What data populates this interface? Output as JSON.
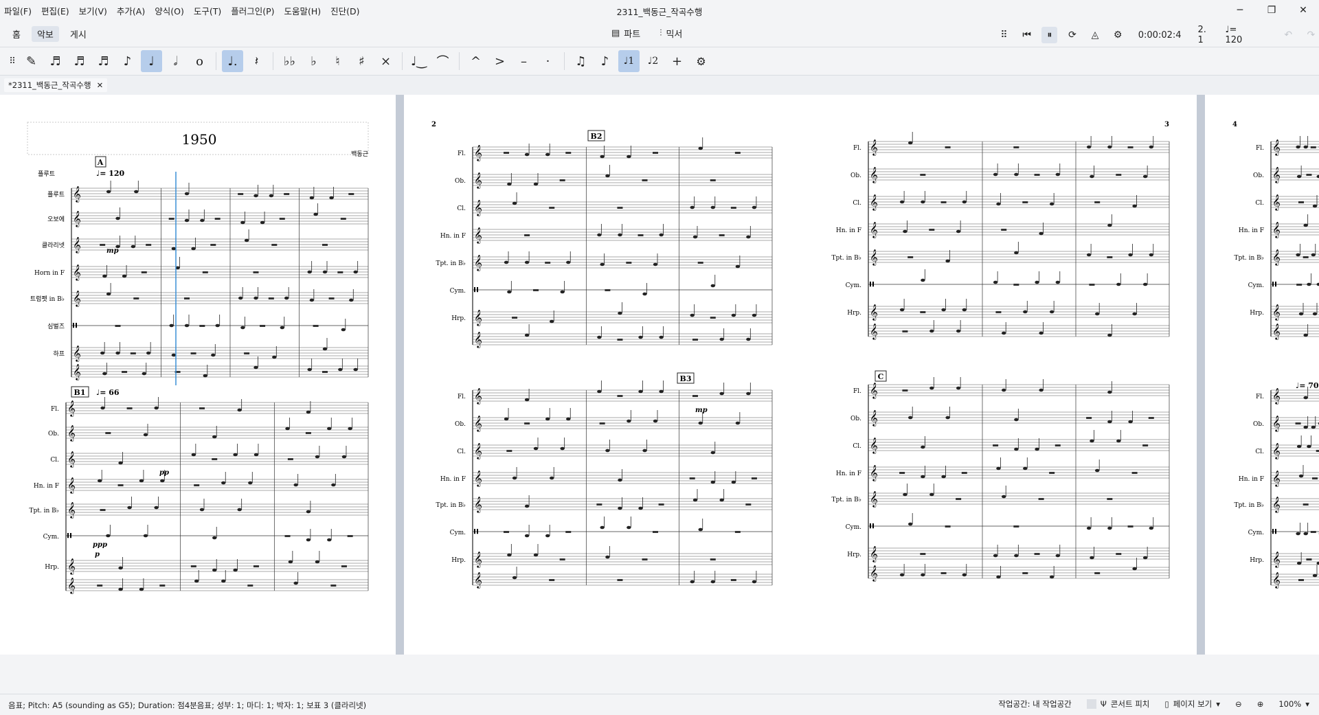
{
  "menubar": {
    "menus": [
      "파일(F)",
      "편집(E)",
      "보기(V)",
      "추가(A)",
      "양식(O)",
      "도구(T)",
      "플러그인(P)",
      "도움말(H)",
      "진단(D)"
    ],
    "window_title": "2311_백동근_작곡수행"
  },
  "nav_tabs": {
    "home": "홈",
    "score": "악보",
    "publish": "게시"
  },
  "center_tabs": {
    "parts": "파트",
    "mixer": "믹서"
  },
  "playback": {
    "time": "0:00:02:4",
    "position": "2. 1",
    "tempo": "♩= 120"
  },
  "note_input": {
    "tools": [
      "pen-icon",
      "64th-note-icon",
      "32nd-note-icon",
      "16th-note-icon",
      "eighth-note-icon",
      "quarter-note-icon",
      "half-note-icon",
      "whole-note-icon",
      "augmentation-dot-icon",
      "rest-icon",
      "double-flat-icon",
      "flat-icon",
      "natural-icon",
      "sharp-icon",
      "double-sharp-icon",
      "tie-icon",
      "slur-icon",
      "marcato-icon",
      "accent-icon",
      "tenuto-icon",
      "staccato-icon",
      "tuplet-icon",
      "flip-icon",
      "voice-1-icon",
      "voice-2-icon",
      "add-icon",
      "settings-icon"
    ]
  },
  "doc_tab": {
    "label": "*2311_백동근_작곡수행"
  },
  "score": {
    "title": "1950",
    "composer": "백동근",
    "tempo_a": "♩= 120",
    "tempo_b1": "♩= 66",
    "tempo_p4": "♩= 70",
    "rehearsal": [
      "A",
      "B1",
      "B2",
      "B3",
      "C"
    ],
    "page_numbers": [
      "2",
      "3",
      "4"
    ],
    "instruments_p1": [
      "플루트",
      "오보에",
      "클라리넷",
      "Horn in F",
      "트럼펫 in B♭",
      "심벌즈",
      "하프"
    ],
    "instruments_short": [
      "Fl.",
      "Ob.",
      "Cl.",
      "Hn. in F",
      "Tpt. in B♭",
      "Cym.",
      "Hrp."
    ],
    "dynamics": [
      "mp",
      "pp",
      "ppp",
      "p"
    ]
  },
  "status": {
    "message": "음표; Pitch: A5 (sounding as G5); Duration: 점4분음표; 성부: 1; 마디: 1; 박자: 1; 보표 3 (클라리넷)",
    "workspace": "작업공간: 내 작업공간",
    "concert_pitch": "콘서트 피치",
    "page_view": "페이지 보기",
    "zoom": "100%"
  }
}
